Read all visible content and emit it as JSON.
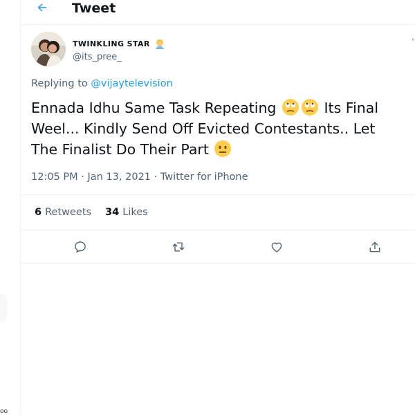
{
  "header": {
    "title": "Tweet"
  },
  "tweet": {
    "display_name": "TWINKLING STAR",
    "handle": "@its_pree_",
    "replying_prefix": "Replying to",
    "replying_to": "@vijaytelevision",
    "text_part1": "Ennada Idhu Same Task Repeating",
    "text_part2": "Its Final Weel... Kindly Send Off Evicted Contestants.. Let The Finalist Do Their Part",
    "time": "12:05 PM",
    "date": "Jan 13, 2021",
    "source": "Twitter for iPhone",
    "separator": "·"
  },
  "stats": {
    "retweets_count": "6",
    "retweets_label": "Retweets",
    "likes_count": "34",
    "likes_label": "Likes"
  },
  "icons": {
    "back": "back-arrow-icon",
    "name_badge": "person-emoji-icon",
    "reply": "reply-icon",
    "retweet": "retweet-icon",
    "like": "heart-icon",
    "share": "share-icon"
  },
  "colors": {
    "accent": "#1d9bf0",
    "secondary_text": "#536471",
    "text": "#0f1419",
    "border": "#eff3f4"
  }
}
